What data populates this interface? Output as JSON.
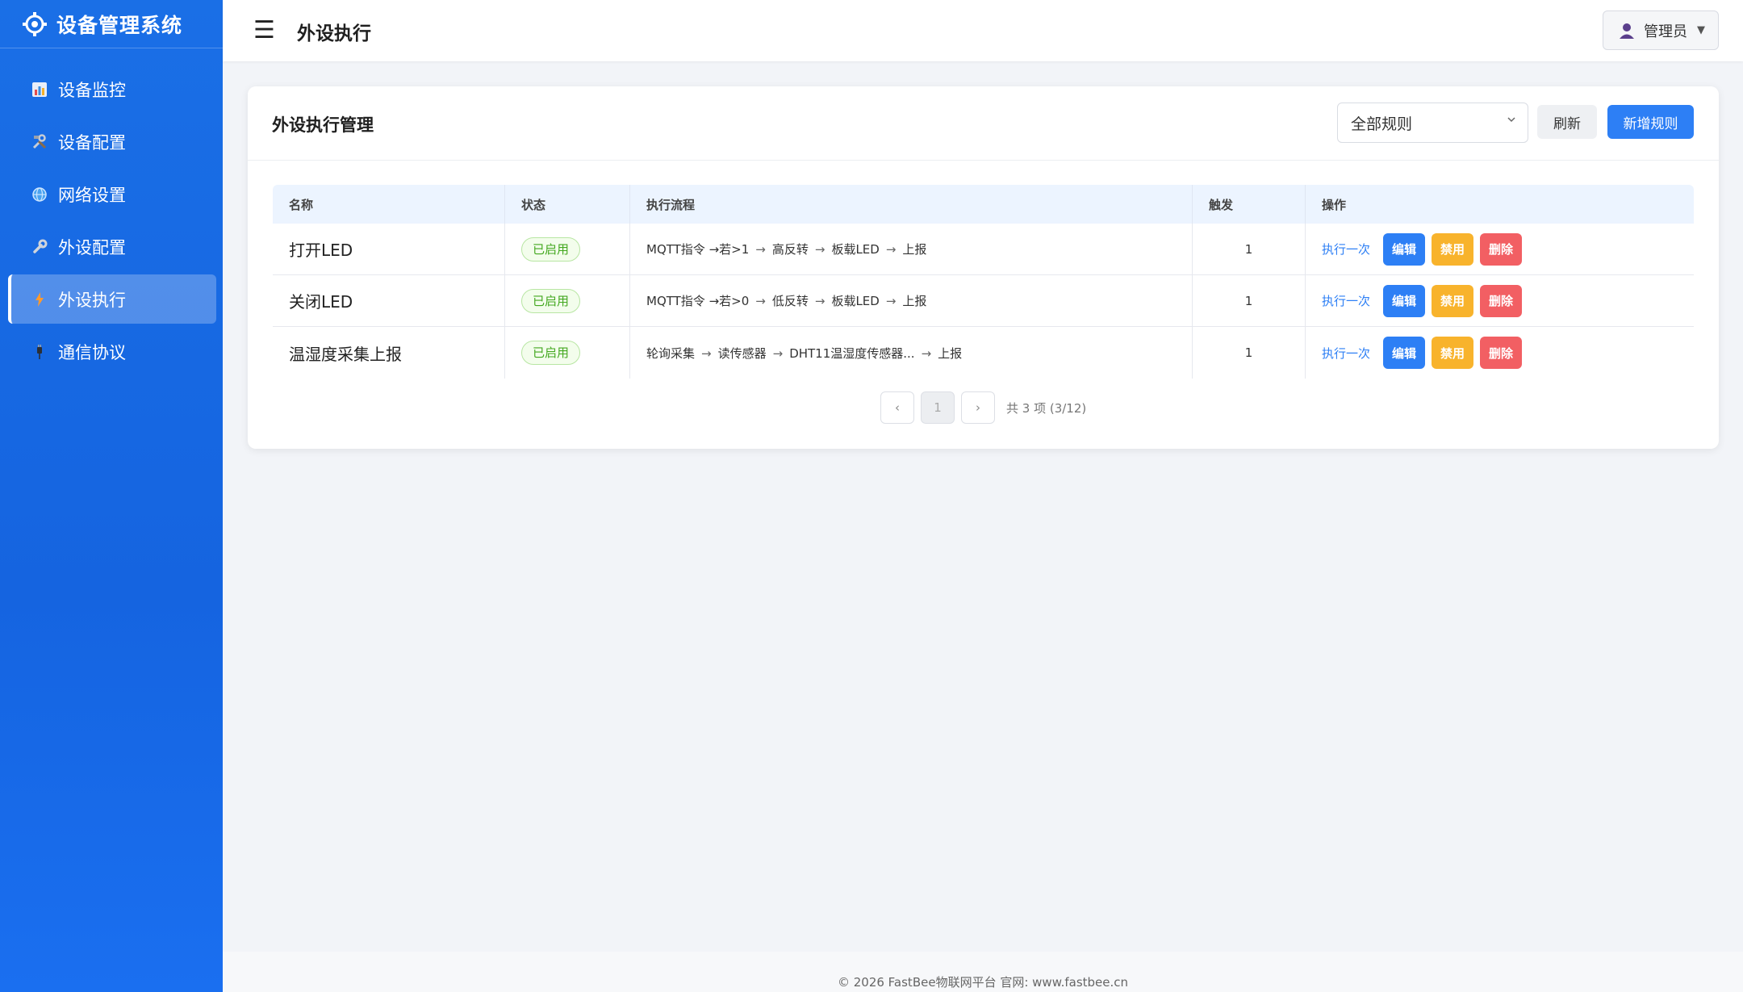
{
  "brand": {
    "title": "设备管理系统",
    "icon": "gear-chip-logo"
  },
  "sidebar": {
    "items": [
      {
        "label": "设备监控",
        "icon": "bar-chart-icon",
        "active": false
      },
      {
        "label": "设备配置",
        "icon": "tools-icon",
        "active": false
      },
      {
        "label": "网络设置",
        "icon": "globe-icon",
        "active": false
      },
      {
        "label": "外设配置",
        "icon": "wrench-icon",
        "active": false
      },
      {
        "label": "外设执行",
        "icon": "lightning-icon",
        "active": true
      },
      {
        "label": "通信协议",
        "icon": "plug-icon",
        "active": false
      }
    ]
  },
  "header": {
    "menu_icon": "☰",
    "title": "外设执行",
    "user_label": "管理员",
    "user_caret": "▼"
  },
  "card": {
    "title": "外设执行管理",
    "filter_selected": "全部规则",
    "refresh_label": "刷新",
    "add_label": "新增规则"
  },
  "table": {
    "columns": [
      "名称",
      "状态",
      "执行流程",
      "触发",
      "操作"
    ],
    "rows": [
      {
        "name": "打开LED",
        "status": "已启用",
        "flow": [
          "MQTT指令 →若>1",
          "高反转",
          "板载LED",
          "上报"
        ],
        "trigger": "1"
      },
      {
        "name": "关闭LED",
        "status": "已启用",
        "flow": [
          "MQTT指令 →若>0",
          "低反转",
          "板载LED",
          "上报"
        ],
        "trigger": "1"
      },
      {
        "name": "温湿度采集上报",
        "status": "已启用",
        "flow": [
          "轮询采集",
          "读传感器",
          "DHT11温湿度传感器...",
          "上报"
        ],
        "trigger": "1"
      }
    ],
    "ops": {
      "run_once": "执行一次",
      "edit": "编辑",
      "disable": "禁用",
      "delete": "删除"
    }
  },
  "pagination": {
    "prev": "‹",
    "current": "1",
    "next": "›",
    "info": "共 3 项 (3/12)"
  },
  "footer": {
    "text": "© 2026 FastBee物联网平台 官网: www.fastbee.cn"
  },
  "colors": {
    "sidebar": "#1a6fe6",
    "primary": "#2d7ff5",
    "warning": "#f8b32c",
    "danger": "#f25f63",
    "success": "#43a81f"
  }
}
